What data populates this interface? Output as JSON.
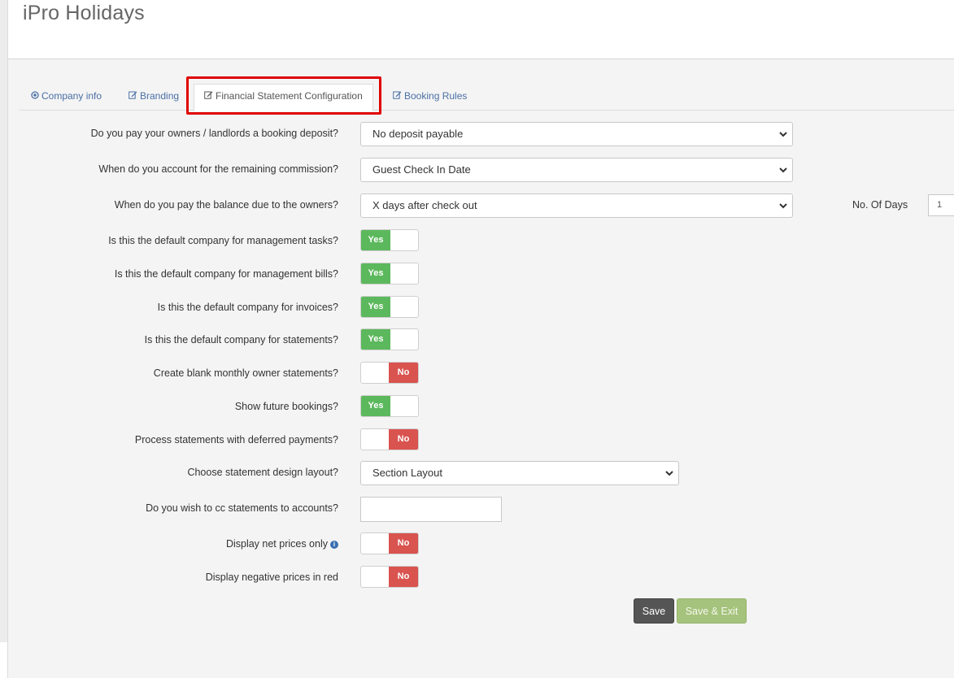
{
  "app": {
    "title": "iPro Holidays"
  },
  "tabs": [
    {
      "label": "Company info",
      "icon": "target-circle-icon"
    },
    {
      "label": "Branding",
      "icon": "edit-icon"
    },
    {
      "label": "Financial Statement Configuration",
      "icon": "edit-icon",
      "active": true
    },
    {
      "label": "Booking Rules",
      "icon": "edit-icon"
    }
  ],
  "form": {
    "deposit": {
      "label": "Do you pay your owners / landlords a booking deposit?",
      "value": "No deposit payable"
    },
    "commission": {
      "label": "When do you account for the remaining commission?",
      "value": "Guest Check In Date"
    },
    "balance": {
      "label": "When do you pay the balance due to the owners?",
      "value": "X days after check out",
      "days_label": "No. Of Days",
      "days_value": "1"
    },
    "mgmt_tasks": {
      "label": "Is this the default company for management tasks?",
      "state": "Yes"
    },
    "mgmt_bills": {
      "label": "Is this the default company for management bills?",
      "state": "Yes"
    },
    "invoices": {
      "label": "Is this the default company for invoices?",
      "state": "Yes"
    },
    "statements": {
      "label": "Is this the default company for statements?",
      "state": "Yes"
    },
    "blank_statements": {
      "label": "Create blank monthly owner statements?",
      "state": "No"
    },
    "future_bookings": {
      "label": "Show future bookings?",
      "state": "Yes"
    },
    "deferred": {
      "label": "Process statements with deferred payments?",
      "state": "No"
    },
    "design_layout": {
      "label": "Choose statement design layout?",
      "value": "Section Layout"
    },
    "cc_statements": {
      "label": "Do you wish to cc statements to accounts?",
      "value": ""
    },
    "net_prices": {
      "label": "Display net prices only",
      "state": "No"
    },
    "negative_red": {
      "label": "Display negative prices in red",
      "state": "No"
    }
  },
  "actions": {
    "save": "Save",
    "save_exit": "Save & Exit"
  },
  "colors": {
    "yes": "#5cb85c",
    "no": "#d9534f",
    "highlight": "#e00000",
    "link": "#4a6fa5"
  }
}
